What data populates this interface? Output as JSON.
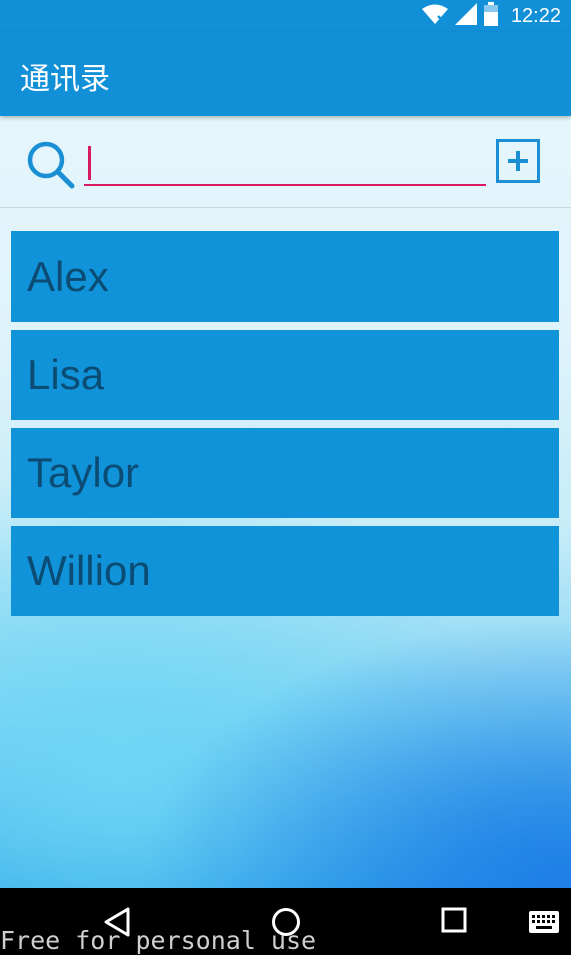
{
  "status_bar": {
    "time": "12:22",
    "icons": [
      "wifi-icon",
      "cell-signal-icon",
      "battery-icon"
    ]
  },
  "toolbar": {
    "title": "通讯录"
  },
  "search": {
    "value": "",
    "icon": "search-icon",
    "add_icon": "add-box-icon"
  },
  "contacts": [
    {
      "name": "Alex"
    },
    {
      "name": "Lisa"
    },
    {
      "name": "Taylor"
    },
    {
      "name": "Willion"
    }
  ],
  "nav_bar": {
    "buttons": [
      "back-icon",
      "home-icon",
      "recents-icon",
      "keyboard-icon"
    ]
  },
  "watermark": "Free for personal use",
  "colors": {
    "primary": "#1190d8",
    "list_item": "#1193da",
    "list_text": "#0b4c74",
    "accent": "#d81b60"
  }
}
